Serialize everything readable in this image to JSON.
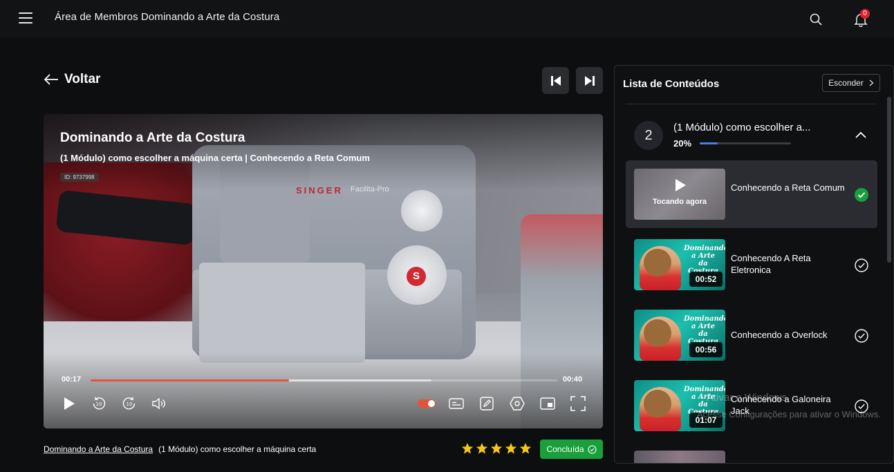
{
  "topbar": {
    "title": "Área de Membros Dominando a Arte da Costura",
    "notification_count": "0"
  },
  "nav": {
    "back_label": "Voltar"
  },
  "player": {
    "title": "Dominando a Arte da Costura",
    "subtitle": "(1 Módulo) como escolher a máquina certa | Conhecendo a Reta Comum",
    "video_id": "ID: 9737998",
    "brand": "SINGER",
    "model": "Facilita-Pro",
    "time_current": "00:17",
    "time_total": "00:40",
    "progress_fraction": 0.425,
    "buffer_fraction": 0.73,
    "rewind_seconds": "10",
    "forward_seconds": "10"
  },
  "breadcrumb": {
    "course": "Dominando a Arte da Costura",
    "module": "(1 Módulo) como escolher a máquina certa"
  },
  "rating": {
    "stars": 5,
    "max": 5
  },
  "complete_button": {
    "label": "Concluída"
  },
  "panel": {
    "title": "Lista de Conteúdos",
    "hide_label": "Esconder",
    "module": {
      "number": "2",
      "title": "(1 Módulo) como escolher a...",
      "progress_label": "20%",
      "progress_fraction": 0.2
    },
    "lessons": [
      {
        "title": "Conhecendo a Reta Comum",
        "status": "Tocando agora",
        "duration": "",
        "completed": true,
        "active": true
      },
      {
        "title": "Conhecendo A Reta Eletronica",
        "status": "",
        "duration": "00:52",
        "completed": false,
        "active": false
      },
      {
        "title": "Conhecendo a Overlock",
        "status": "",
        "duration": "00:56",
        "completed": false,
        "active": false
      },
      {
        "title": "Conhecendo a Galoneira Jack",
        "status": "",
        "duration": "01:07",
        "completed": false,
        "active": false
      }
    ],
    "thumb_logo_line1": "Dominando",
    "thumb_logo_line2": "a Arte",
    "thumb_logo_line3": "da Costura"
  },
  "watermark": {
    "line1": "Ativar o Windows",
    "line2": "Acesse Configurações para ativar o Windows."
  },
  "colors": {
    "accent": "#e05538",
    "success": "#19a03c",
    "progress_blue": "#4f7be6",
    "star": "#f5c518",
    "badge": "#e0202b"
  }
}
